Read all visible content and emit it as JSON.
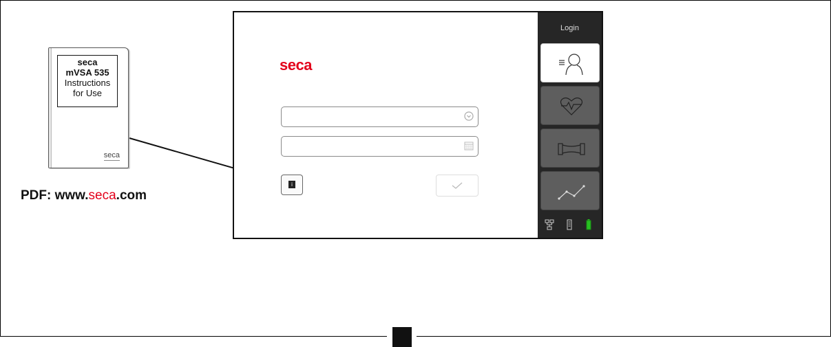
{
  "booklet": {
    "brand": "seca",
    "model": "mVSA 535",
    "line1": "Instructions",
    "line2": "for Use",
    "footer_logo": "seca"
  },
  "pdf": {
    "prefix": "PDF: www.",
    "brand": "seca",
    "suffix": ".com"
  },
  "screen": {
    "brand": "seca",
    "field1_icon": "clock-icon",
    "field2_icon": "calendar-icon",
    "info_icon": "info-book-icon",
    "ok_icon": "check-icon"
  },
  "sidebar": {
    "login": "Login",
    "items": [
      {
        "name": "patient",
        "icon": "patient-list-icon",
        "active": true
      },
      {
        "name": "vitals",
        "icon": "heart-icon",
        "active": false
      },
      {
        "name": "measurement",
        "icon": "length-icon",
        "active": false
      },
      {
        "name": "trend",
        "icon": "trend-icon",
        "active": false
      }
    ],
    "status_icons": [
      "network-icon",
      "thermometer-icon",
      "battery-icon"
    ]
  },
  "colors": {
    "brand_red": "#e3001b",
    "sidebar": "#262626",
    "battery": "#27c021"
  }
}
